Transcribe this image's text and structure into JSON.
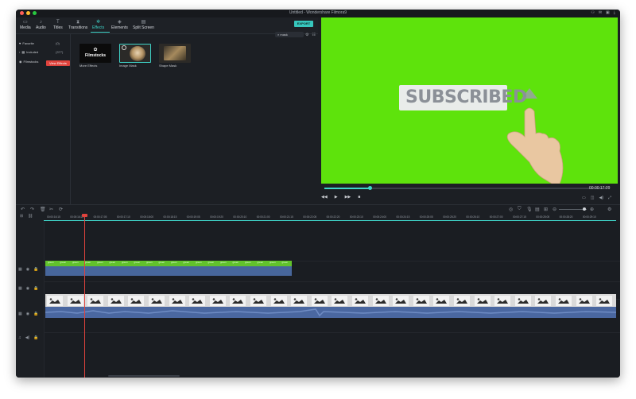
{
  "window": {
    "title": "Untitled - Wondershare Filmora9"
  },
  "tabs": [
    {
      "label": "Media",
      "icon": "folder-icon"
    },
    {
      "label": "Audio",
      "icon": "music-icon"
    },
    {
      "label": "Titles",
      "icon": "text-icon"
    },
    {
      "label": "Transitions",
      "icon": "transition-icon"
    },
    {
      "label": "Effects",
      "icon": "effects-icon"
    },
    {
      "label": "Elements",
      "icon": "elements-icon"
    },
    {
      "label": "Split Screen",
      "icon": "split-screen-icon"
    }
  ],
  "active_tab": "Effects",
  "export_label": "EXPORT",
  "sidebar": {
    "items": [
      {
        "label": "Favorite",
        "count": "(0)"
      },
      {
        "label": "Included",
        "count": "(377)"
      },
      {
        "label": "Filmstocks"
      }
    ],
    "view_effects_button": "View Effects"
  },
  "search": {
    "value": "mask"
  },
  "effects": [
    {
      "label": "More Effects",
      "badge": "Filmstocks"
    },
    {
      "label": "Image Mask"
    },
    {
      "label": "Shape Mask"
    }
  ],
  "preview": {
    "overlay_text": "SUBSCRIBED",
    "timecode": "00:00:17:09",
    "progress_fraction": 0.16
  },
  "ruler_ticks": [
    "00:00:16:15",
    "00:00:16:20",
    "00:00:17:05",
    "00:00:17:10",
    "00:00:18:00",
    "00:00:18:15",
    "00:00:19:05",
    "00:00:19:20",
    "00:00:20:10",
    "00:00:21:00",
    "00:00:21:15",
    "00:00:22:05",
    "00:00:22:20",
    "00:00:23:10",
    "00:00:24:00",
    "00:00:24:15",
    "00:00:25:05",
    "00:00:25:20",
    "00:00:26:10",
    "00:00:27:00",
    "00:00:27:15",
    "00:00:28:05",
    "00:00:28:20",
    "00:00:29:10"
  ],
  "clip_label": "green",
  "colors": {
    "accent": "#3fd3c8",
    "playhead": "#e0433d",
    "green_screen": "#5ee30c",
    "audio": "#4a67a0"
  }
}
